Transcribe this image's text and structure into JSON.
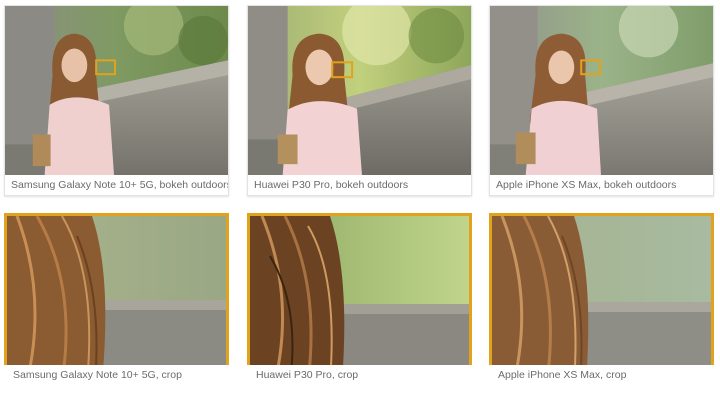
{
  "accent_color": "#e2a31c",
  "rows": [
    {
      "kind": "full",
      "cards": [
        {
          "caption": "Samsung Galaxy Note 10+ 5G, bokeh outdoors"
        },
        {
          "caption": "Huawei P30 Pro, bokeh outdoors"
        },
        {
          "caption": "Apple iPhone XS Max, bokeh outdoors"
        }
      ]
    },
    {
      "kind": "crop",
      "cards": [
        {
          "caption": "Samsung Galaxy Note 10+ 5G, crop"
        },
        {
          "caption": "Huawei P30 Pro, crop"
        },
        {
          "caption": "Apple iPhone XS Max, crop"
        }
      ]
    }
  ]
}
